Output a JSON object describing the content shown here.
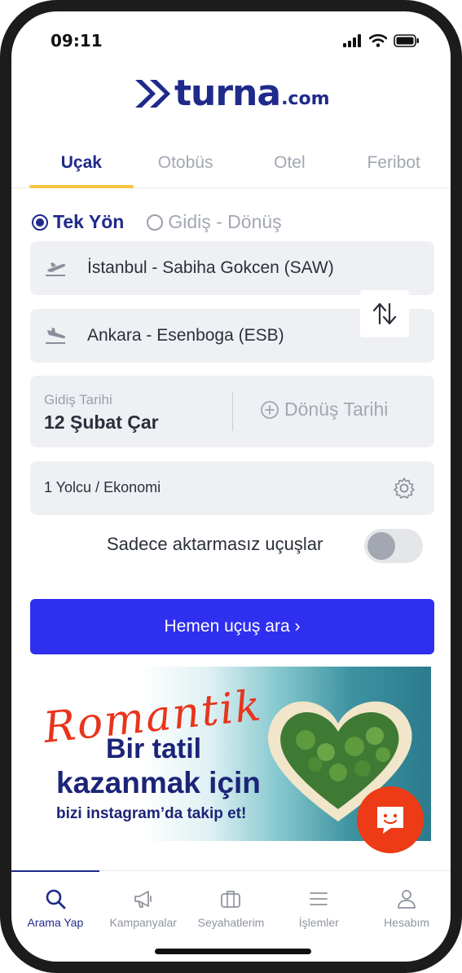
{
  "status_bar": {
    "time": "09:11"
  },
  "brand": {
    "name": "turna",
    "suffix": ".com",
    "color": "#1f2a8a"
  },
  "tabs": [
    {
      "label": "Uçak",
      "active": true
    },
    {
      "label": "Otobüs",
      "active": false
    },
    {
      "label": "Otel",
      "active": false
    },
    {
      "label": "Feribot",
      "active": false
    }
  ],
  "trip_type": {
    "one_way": "Tek Yön",
    "round_trip": "Gidiş - Dönüş",
    "selected": "one_way"
  },
  "route": {
    "from": "İstanbul - Sabiha Gokcen (SAW)",
    "to": "Ankara - Esenboga (ESB)",
    "from_icon": "plane-takeoff-icon",
    "to_icon": "plane-landing-icon",
    "swap_icon": "swap-arrows-icon"
  },
  "dates": {
    "departure_label": "Gidiş Tarihi",
    "departure_value": "12 Şubat Çar",
    "return_label": "Dönüş Tarihi"
  },
  "passengers": {
    "value": "1 Yolcu / Ekonomi",
    "icon": "gear-icon"
  },
  "nonstop": {
    "label": "Sadece aktarmasız uçuşlar",
    "enabled": false
  },
  "search_button": {
    "label": "Hemen uçuş ara ›",
    "color": "#2f2ff0"
  },
  "banner": {
    "script_text": "Romantik",
    "line1": "Bir tatil",
    "line2": "kazanmak için",
    "line3": "bizi instagram’da takip et!"
  },
  "chat_button": {
    "icon": "chat-face-icon",
    "color": "#ec3b16"
  },
  "bottom_nav": [
    {
      "label": "Arama Yap",
      "icon": "search-icon",
      "active": true
    },
    {
      "label": "Kampanyalar",
      "icon": "megaphone-icon",
      "active": false
    },
    {
      "label": "Seyahatlerim",
      "icon": "briefcase-icon",
      "active": false
    },
    {
      "label": "İşlemler",
      "icon": "menu-icon",
      "active": false
    },
    {
      "label": "Hesabım",
      "icon": "user-icon",
      "active": false
    }
  ]
}
